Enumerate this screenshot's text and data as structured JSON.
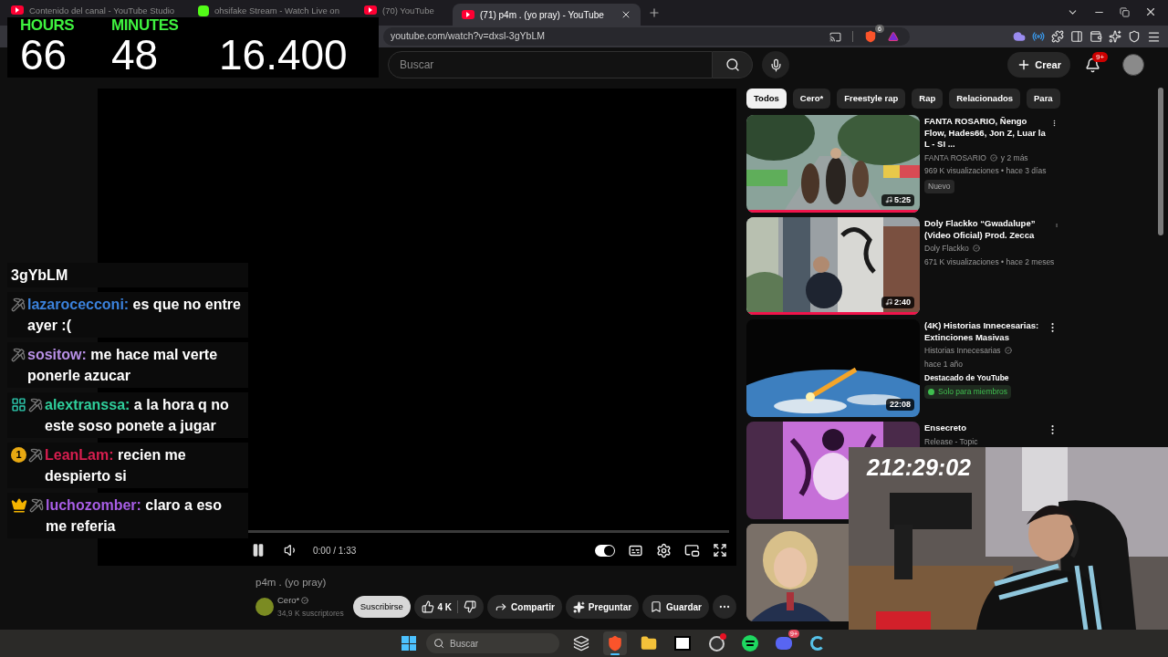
{
  "browser": {
    "tabs": [
      {
        "title": "Contenido del canal - YouTube Studio",
        "kind": "studio",
        "selected": false
      },
      {
        "title": "ohsifake Stream - Watch Live on",
        "kind": "kick",
        "selected": false
      },
      {
        "title": "(70) YouTube",
        "kind": "youtube",
        "selected": false
      },
      {
        "title": "(71) p4m . (yo pray) - YouTube",
        "kind": "youtube",
        "selected": true
      }
    ],
    "url": "youtube.com/watch?v=dxsl-3gYbLM",
    "shield_badge": "6"
  },
  "timer_overlay": {
    "segments": [
      {
        "label": "HOURS",
        "value": "66"
      },
      {
        "label": "MINUTES",
        "value": "48"
      },
      {
        "value": "16.400"
      }
    ]
  },
  "header": {
    "search": {
      "placeholder": "Buscar"
    },
    "create_label": "Crear",
    "notifications": "9+"
  },
  "player": {
    "playing": true,
    "time": "0:00 / 1:33",
    "autoplay": true
  },
  "video": {
    "title": "p4m . (yo pray)",
    "channel": "Cero*",
    "verified": true,
    "subscribers": "34,9 K suscriptores",
    "subscribe_label": "Suscribirse",
    "likes": "4 K",
    "actions": [
      {
        "kind": "share",
        "label": "Compartir"
      },
      {
        "kind": "ask",
        "label": "Preguntar"
      },
      {
        "kind": "save",
        "label": "Guardar"
      },
      {
        "kind": "more"
      }
    ]
  },
  "chips": [
    {
      "label": "Todos",
      "selected": true
    },
    {
      "label": "Cero*",
      "selected": false
    },
    {
      "label": "Freestyle rap",
      "selected": false
    },
    {
      "label": "Rap",
      "selected": false
    },
    {
      "label": "Relacionados",
      "selected": false
    },
    {
      "label": "Para",
      "selected": false
    }
  ],
  "recommendations": [
    {
      "title": "FANTA ROSARIO, Ñengo Flow, Hades66, Jon Z,  Luar la L - SI ...",
      "channel": "FANTA ROSARIO",
      "verified": true,
      "channel_extra": "y 2 más",
      "meta": [
        "969 K visualizaciones • hace 3 días"
      ],
      "badge": {
        "kind": "plain",
        "label": "Nuevo"
      },
      "duration": "5:25",
      "music": true,
      "progress": {
        "level": 1
      }
    },
    {
      "title": "Doly Flackko “Gwadalupe” (Video Oficial) Prod. Zecca",
      "channel": "Doly Flackko",
      "verified": true,
      "meta": [
        "671 K visualizaciones • hace 2 meses"
      ],
      "duration": "2:40",
      "music": true,
      "progress": {
        "level": 1
      }
    },
    {
      "title": "(4K) Historias Innecesarias: Extinciones Masivas",
      "channel": "Historias Innecesarias",
      "verified": true,
      "meta": [
        "hace 1 año"
      ],
      "featured": "Destacado de YouTube",
      "badge": {
        "kind": "members",
        "label": "Solo para miembros"
      },
      "duration": "22:08"
    },
    {
      "title": "Ensecreto",
      "channel": "Release - Topic"
    }
  ],
  "chat": {
    "messages": [
      {
        "kind": "fragment",
        "text": "3gYbLM"
      },
      {
        "kind": "message",
        "user": "lazarocecconi:",
        "color": "#3b82dc",
        "text": "es que no entre ayer :("
      },
      {
        "kind": "message",
        "user": "sositow:",
        "color": "#b890e6",
        "text": "me hace mal verte ponerle azucar"
      },
      {
        "kind": "message",
        "badge": {
          "kind": "grid"
        },
        "user": "alextranssa:",
        "color": "#2fcf9c",
        "text": "a la hora q no este soso ponete a jugar"
      },
      {
        "kind": "message",
        "badge": {
          "kind": "tier",
          "text": "1"
        },
        "user": "LeanLam:",
        "color": "#d81e4f",
        "text": "recien me despierto si"
      },
      {
        "kind": "message",
        "badge": {
          "kind": "crown"
        },
        "user": "luchozomber:",
        "color": "#a85ee6",
        "text": "claro a eso me referia"
      }
    ]
  },
  "webcam": {
    "kind": "picture",
    "timer": "212:29:02"
  },
  "taskbar": {
    "search_placeholder": "Buscar",
    "apps": [
      {
        "kind": "task-view",
        "selected": false,
        "dot": false
      },
      {
        "kind": "brave",
        "selected": true,
        "dot": false
      },
      {
        "kind": "folder",
        "selected": false,
        "dot": false
      },
      {
        "kind": "dc",
        "selected": false,
        "dot": false
      },
      {
        "kind": "obs",
        "selected": false,
        "dot": true
      },
      {
        "kind": "spotify",
        "selected": false,
        "dot": false
      },
      {
        "kind": "discord",
        "selected": false,
        "dot": false,
        "badge": "9+"
      },
      {
        "kind": "c-app",
        "selected": false,
        "dot": false
      }
    ]
  }
}
